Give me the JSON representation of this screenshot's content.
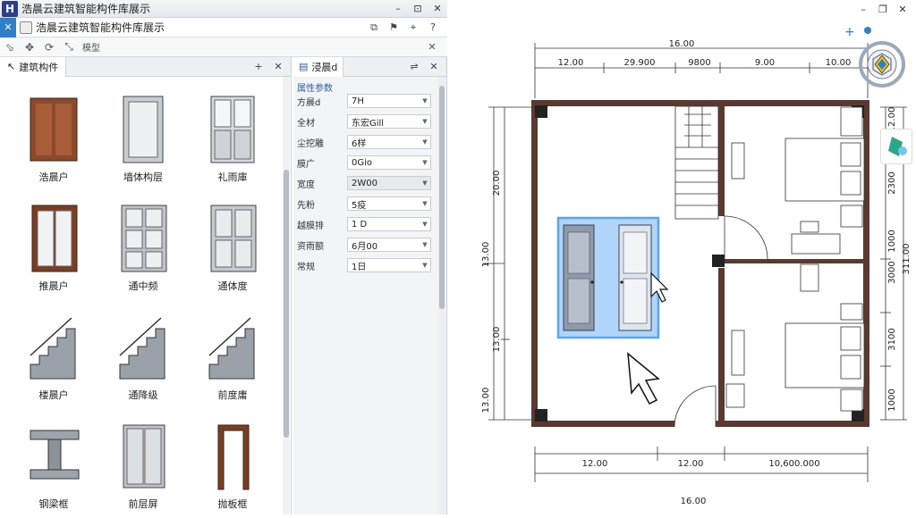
{
  "window": {
    "title": "浩晨云建筑智能构件库展示",
    "logo": "H"
  },
  "panel": {
    "title": "浩晨云建筑智能构件库展示"
  },
  "toolbar": {
    "label": "模型"
  },
  "library": {
    "tab": "建筑构件",
    "items": [
      {
        "label": "浩晨户",
        "icon": "cabinet-door-icon"
      },
      {
        "label": "墙体构层",
        "icon": "single-door-icon"
      },
      {
        "label": "礼雨庫",
        "icon": "glass-double-door-icon"
      },
      {
        "label": "推晨户",
        "icon": "brown-double-door-icon"
      },
      {
        "label": "通中频",
        "icon": "panel-door-icon"
      },
      {
        "label": "通体度",
        "icon": "double-door-icon"
      },
      {
        "label": "楼晨户",
        "icon": "stair-icon"
      },
      {
        "label": "通降级",
        "icon": "stair-icon"
      },
      {
        "label": "前度庸",
        "icon": "stair-icon"
      },
      {
        "label": "钢梁框",
        "icon": "steel-beam-icon"
      },
      {
        "label": "前层屏",
        "icon": "cabinet-icon"
      },
      {
        "label": "抛板框",
        "icon": "door-frame-icon"
      }
    ]
  },
  "properties": {
    "tab": "浸晨d",
    "section": "属性参数",
    "rows": [
      {
        "key": "方晨d",
        "value": "7H"
      },
      {
        "key": "全材",
        "value": "东宏Gill"
      },
      {
        "key": "尘挖雕",
        "value": "6样"
      },
      {
        "key": "膜广",
        "value": "0Gio"
      },
      {
        "key": "宽度",
        "value": "2W00",
        "highlight": true
      },
      {
        "key": "先粉",
        "value": "5疫"
      },
      {
        "key": "越膜排",
        "value": "1 D"
      },
      {
        "key": "资雨额",
        "value": "6月00"
      },
      {
        "key": "常规",
        "value": "1日"
      }
    ]
  },
  "drawing": {
    "top_dims": {
      "overall": "16.00",
      "segments": [
        "12.00",
        "29.900",
        "9800",
        "9.00",
        "10.00"
      ]
    },
    "bottom_dims": {
      "overall": "16.00",
      "segments": [
        "12.00",
        "12.00",
        "10,600.000"
      ]
    },
    "left_dims": [
      "20.00",
      "13.00",
      "13.00",
      "13.00"
    ],
    "right_dims": [
      "12.00",
      "2300",
      "1000",
      "3000",
      "3100",
      "1000",
      "311.00"
    ]
  },
  "colors": {
    "accent": "#2f80c8",
    "wall": "#5a3a30",
    "highlight": "#4a9bf0"
  }
}
